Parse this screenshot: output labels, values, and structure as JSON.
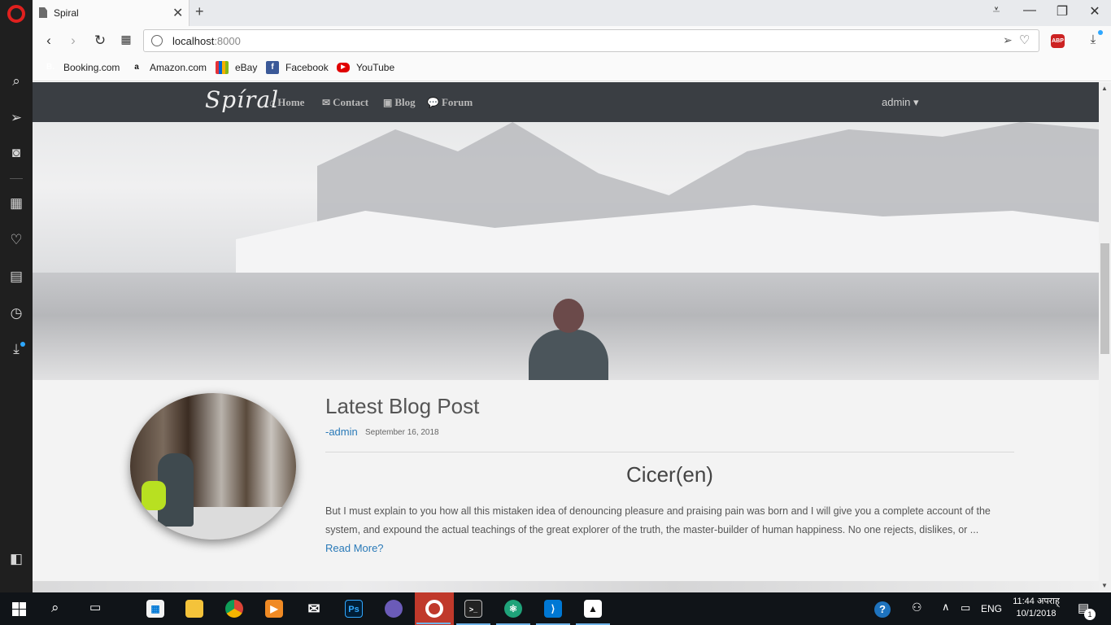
{
  "browser": {
    "tab": {
      "title": "Spiral",
      "close": "✕",
      "new_tab": "+"
    },
    "window_controls": {
      "menu": "⩡",
      "minimize": "—",
      "restore": "❐",
      "close": "✕"
    },
    "address": {
      "host": "localhost",
      "port": ":8000"
    },
    "bookmarks": [
      {
        "label": "Booking.com",
        "icon": "booking-icon",
        "glyph": "B.",
        "color": "#003580"
      },
      {
        "label": "Amazon.com",
        "icon": "amazon-icon",
        "glyph": "a",
        "color": "#111111"
      },
      {
        "label": "eBay",
        "icon": "ebay-icon",
        "glyph": "▦",
        "color": "#e53238"
      },
      {
        "label": "Facebook",
        "icon": "facebook-icon",
        "glyph": "f",
        "color": "#3b5998"
      },
      {
        "label": "YouTube",
        "icon": "youtube-icon",
        "glyph": "▶",
        "color": "#e00000"
      }
    ],
    "abp_label": "ABP"
  },
  "site": {
    "brand": "Spíral",
    "nav": [
      {
        "label": "Home",
        "icon": "home-icon",
        "glyph": "⌂"
      },
      {
        "label": "Contact",
        "icon": "envelope-icon",
        "glyph": "✉"
      },
      {
        "label": "Blog",
        "icon": "blog-icon",
        "glyph": "▣"
      },
      {
        "label": "Forum",
        "icon": "comments-icon",
        "glyph": "💬"
      }
    ],
    "user_menu": "admin ▾"
  },
  "blog": {
    "section_title": "Latest Blog Post",
    "author": "-admin",
    "date": "September 16, 2018",
    "post_title": "Cicer(en)",
    "excerpt": "But I must explain to you how all this mistaken idea of denouncing pleasure and praising pain was born and I will give you a complete account of the system, and expound the actual teachings of the great explorer of the truth, the master-builder of human happiness. No one rejects, dislikes, or ...",
    "read_more": "Read More?"
  },
  "taskbar": {
    "lang": "ENG",
    "time": "11:44 अपराह्",
    "date": "10/1/2018",
    "notification_count": "1"
  },
  "colors": {
    "navbar": "#3a3e43",
    "link": "#2a7ab8",
    "opera_red": "#e0201e",
    "page_bg": "#f3f3f3"
  }
}
